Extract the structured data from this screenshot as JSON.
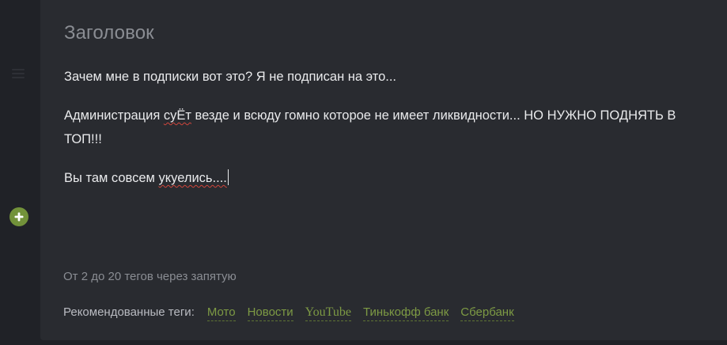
{
  "editor": {
    "title_placeholder": "Заголовок",
    "paragraphs": [
      "Зачем мне в подписки вот это? Я не подписан на это...",
      "Администрация суЁт везде и всюду гомно которое не имеет ликвидности... НО НУЖНО ПОДНЯТЬ В ТОП!!!",
      "Вы там совсем укуелись...."
    ],
    "p2": {
      "before": "Администрация ",
      "misspelled": "суЁт",
      "after": " везде и всюду гомно которое не имеет ликвидности... НО НУЖНО ПОДНЯТЬ В ТОП!!!"
    },
    "p3": {
      "before": "Вы там совсем ",
      "misspelled": "укуелись...."
    }
  },
  "tags": {
    "input_placeholder": "От 2 до 20 тегов через запятую",
    "recommended_label": "Рекомендованные теги:",
    "recommended": [
      "Мото",
      "Новости",
      "YouTube",
      "Тинькофф банк",
      "Сбербанк"
    ]
  },
  "icons": {
    "add_block": "plus-circle-icon",
    "drag": "drag-handle-icon"
  },
  "colors": {
    "accent_green": "#72923a",
    "tag_green": "#7d9a44",
    "panel_bg": "#292b30",
    "page_bg": "#202227",
    "spellcheck_red": "#d0453c"
  }
}
